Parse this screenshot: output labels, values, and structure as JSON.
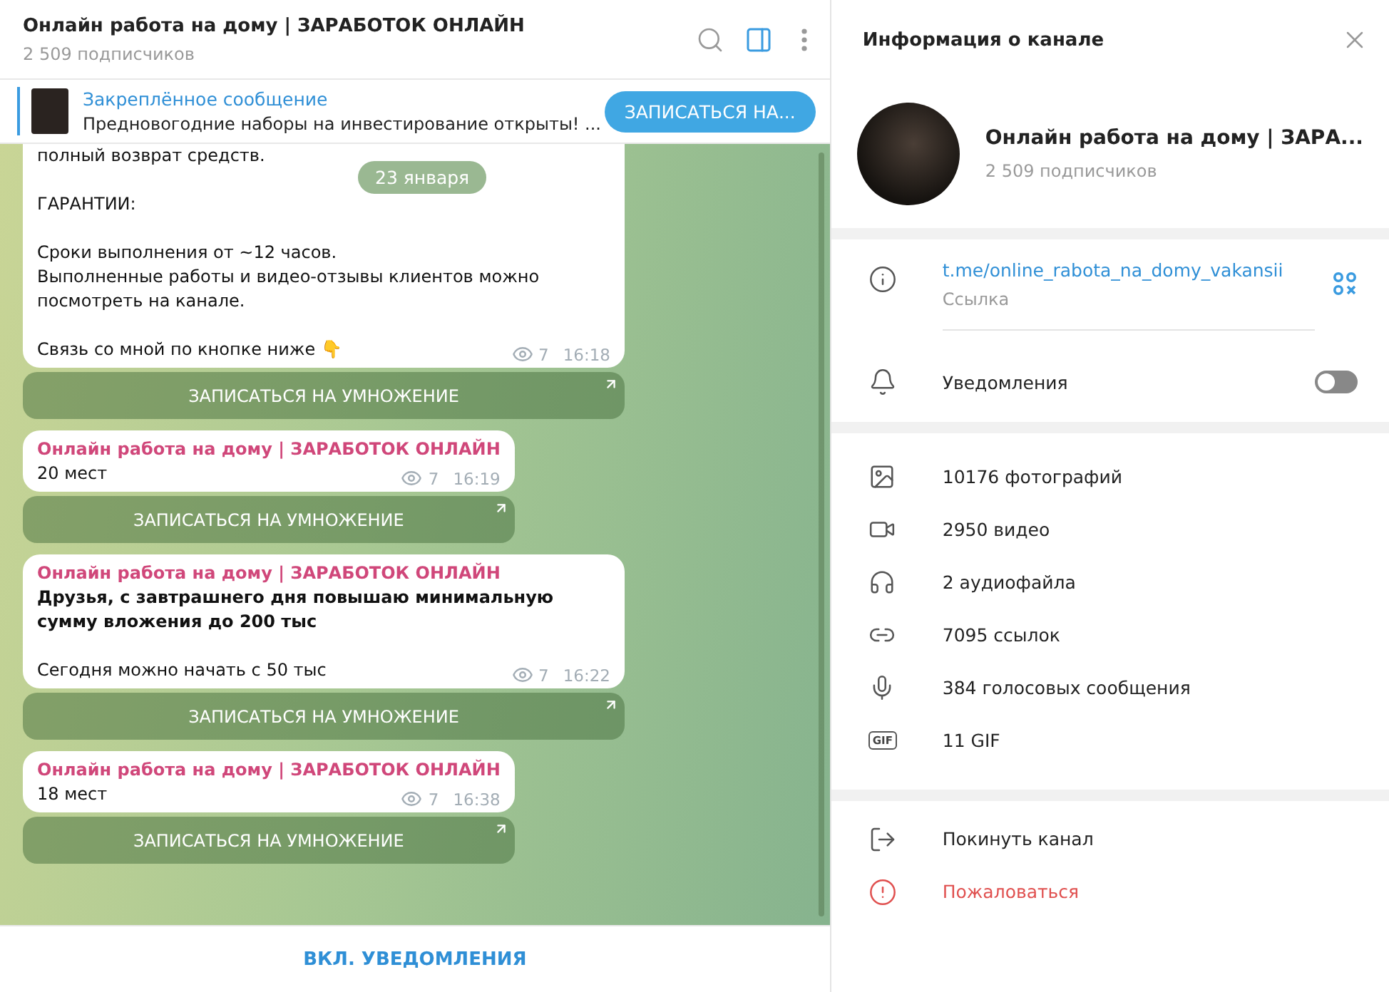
{
  "header": {
    "title": "Онлайн работа на дому | ЗАРАБОТОК ОНЛАЙН",
    "subtitle": "2 509 подписчиков"
  },
  "pinned": {
    "label": "Закреплённое сообщение",
    "text": "Предновогодние наборы на инвестирование открыты!  ...",
    "button": "ЗАПИСАТЬСЯ НА..."
  },
  "chat": {
    "date": "23 января",
    "messages": [
      {
        "paragraphs": [
          {
            "text": "полный возврат средств.",
            "bold": false
          },
          {
            "text": "ГАРАНТИИ:",
            "bold": false
          },
          {
            "text": "Сроки выполнения от ~12 часов.\nВыполненные работы и видео-отзывы клиентов можно посмотреть на канале.",
            "bold": false
          },
          {
            "text": "Связь со мной по кнопке ниже 👇",
            "bold": false
          }
        ],
        "views": "7",
        "time": "16:18",
        "button": "ЗАПИСАТЬСЯ НА УМНОЖЕНИЕ"
      },
      {
        "author": "Онлайн работа на дому | ЗАРАБОТОК ОНЛАЙН",
        "paragraphs": [
          {
            "text": "20 мест",
            "bold": false
          }
        ],
        "views": "7",
        "time": "16:19",
        "button": "ЗАПИСАТЬСЯ НА УМНОЖЕНИЕ"
      },
      {
        "author": "Онлайн работа на дому | ЗАРАБОТОК ОНЛАЙН",
        "paragraphs": [
          {
            "text": "Друзья, с завтрашнего дня повышаю минимальную сумму вложения до 200 тыс",
            "bold": true
          },
          {
            "text": "Сегодня можно начать с 50 тыс",
            "bold": false
          }
        ],
        "views": "7",
        "time": "16:22",
        "button": "ЗАПИСАТЬСЯ НА УМНОЖЕНИЕ"
      },
      {
        "author": "Онлайн работа на дому | ЗАРАБОТОК ОНЛАЙН",
        "paragraphs": [
          {
            "text": "18 мест",
            "bold": false
          }
        ],
        "views": "7",
        "time": "16:38",
        "button": "ЗАПИСАТЬСЯ НА УМНОЖЕНИЕ"
      }
    ]
  },
  "bottom_button": "ВКЛ. УВЕДОМЛЕНИЯ",
  "info": {
    "title": "Информация о канале",
    "name": "Онлайн работа на дому | ЗАРА...",
    "subscribers": "2 509 подписчиков",
    "link": {
      "url": "t.me/online_rabota_na_domy_vakansii",
      "label": "Ссылка"
    },
    "notifications": {
      "label": "Уведомления",
      "on": false
    },
    "media": [
      {
        "kind": "photo",
        "text": "10176 фотографий"
      },
      {
        "kind": "video",
        "text": "2950 видео"
      },
      {
        "kind": "audio",
        "text": "2 аудиофайла"
      },
      {
        "kind": "link",
        "text": "7095 ссылок"
      },
      {
        "kind": "voice",
        "text": "384 голосовых сообщения"
      },
      {
        "kind": "gif",
        "badge": "GIF",
        "text": "11 GIF"
      }
    ],
    "actions": [
      {
        "kind": "leave",
        "text": "Покинуть канал"
      },
      {
        "kind": "report",
        "text": "Пожаловаться"
      }
    ]
  }
}
